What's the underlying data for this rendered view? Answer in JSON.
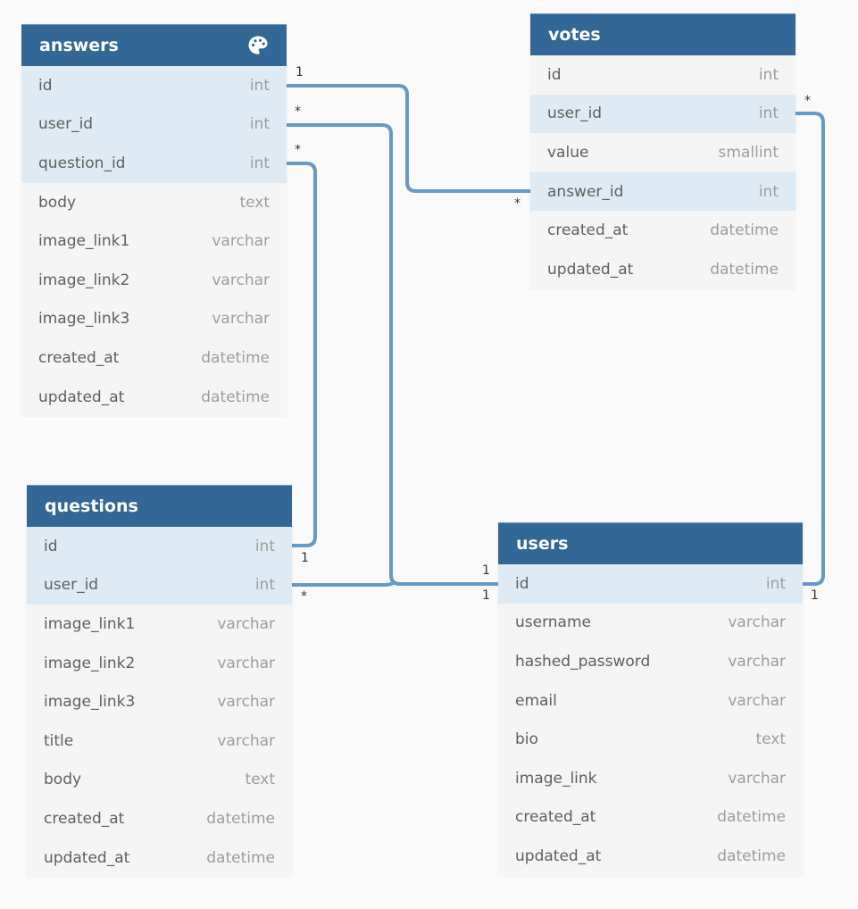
{
  "colors": {
    "header_bg": "#336796",
    "key_row_bg": "#deebf4",
    "row_bg": "#f5f5f5",
    "link": "#6599c6"
  },
  "tables": {
    "answers": {
      "name": "answers",
      "icon": "palette-icon",
      "fields": [
        {
          "name": "id",
          "type": "int",
          "key": true
        },
        {
          "name": "user_id",
          "type": "int",
          "key": true
        },
        {
          "name": "question_id",
          "type": "int",
          "key": true
        },
        {
          "name": "body",
          "type": "text",
          "key": false
        },
        {
          "name": "image_link1",
          "type": "varchar",
          "key": false
        },
        {
          "name": "image_link2",
          "type": "varchar",
          "key": false
        },
        {
          "name": "image_link3",
          "type": "varchar",
          "key": false
        },
        {
          "name": "created_at",
          "type": "datetime",
          "key": false
        },
        {
          "name": "updated_at",
          "type": "datetime",
          "key": false
        }
      ]
    },
    "votes": {
      "name": "votes",
      "fields": [
        {
          "name": "id",
          "type": "int",
          "key": false
        },
        {
          "name": "user_id",
          "type": "int",
          "key": true
        },
        {
          "name": "value",
          "type": "smallint",
          "key": false
        },
        {
          "name": "answer_id",
          "type": "int",
          "key": true
        },
        {
          "name": "created_at",
          "type": "datetime",
          "key": false
        },
        {
          "name": "updated_at",
          "type": "datetime",
          "key": false
        }
      ]
    },
    "questions": {
      "name": "questions",
      "fields": [
        {
          "name": "id",
          "type": "int",
          "key": true
        },
        {
          "name": "user_id",
          "type": "int",
          "key": true
        },
        {
          "name": "image_link1",
          "type": "varchar",
          "key": false
        },
        {
          "name": "image_link2",
          "type": "varchar",
          "key": false
        },
        {
          "name": "image_link3",
          "type": "varchar",
          "key": false
        },
        {
          "name": "title",
          "type": "varchar",
          "key": false
        },
        {
          "name": "body",
          "type": "text",
          "key": false
        },
        {
          "name": "created_at",
          "type": "datetime",
          "key": false
        },
        {
          "name": "updated_at",
          "type": "datetime",
          "key": false
        }
      ]
    },
    "users": {
      "name": "users",
      "fields": [
        {
          "name": "id",
          "type": "int",
          "key": true
        },
        {
          "name": "username",
          "type": "varchar",
          "key": false
        },
        {
          "name": "hashed_password",
          "type": "varchar",
          "key": false
        },
        {
          "name": "email",
          "type": "varchar",
          "key": false
        },
        {
          "name": "bio",
          "type": "text",
          "key": false
        },
        {
          "name": "image_link",
          "type": "varchar",
          "key": false
        },
        {
          "name": "created_at",
          "type": "datetime",
          "key": false
        },
        {
          "name": "updated_at",
          "type": "datetime",
          "key": false
        }
      ]
    }
  },
  "relationships": [
    {
      "from": "answers.id",
      "from_card": "1",
      "to": "votes.answer_id",
      "to_card": "*"
    },
    {
      "from": "answers.user_id",
      "from_card": "*",
      "to": "users.id",
      "to_card": "1"
    },
    {
      "from": "answers.question_id",
      "from_card": "*",
      "to": "questions.id",
      "to_card": "1"
    },
    {
      "from": "questions.user_id",
      "from_card": "*",
      "to": "users.id",
      "to_card": "1"
    },
    {
      "from": "votes.user_id",
      "from_card": "*",
      "to": "users.id",
      "to_card": "1"
    }
  ],
  "cards": {
    "answers_id": "1",
    "answers_user_id": "*",
    "answers_question_id": "*",
    "votes_answer_id": "*",
    "votes_user_id": "*",
    "questions_id": "1",
    "questions_user_id": "*",
    "users_id_top": "1",
    "users_id_bottom": "1",
    "users_id_right": "1"
  }
}
